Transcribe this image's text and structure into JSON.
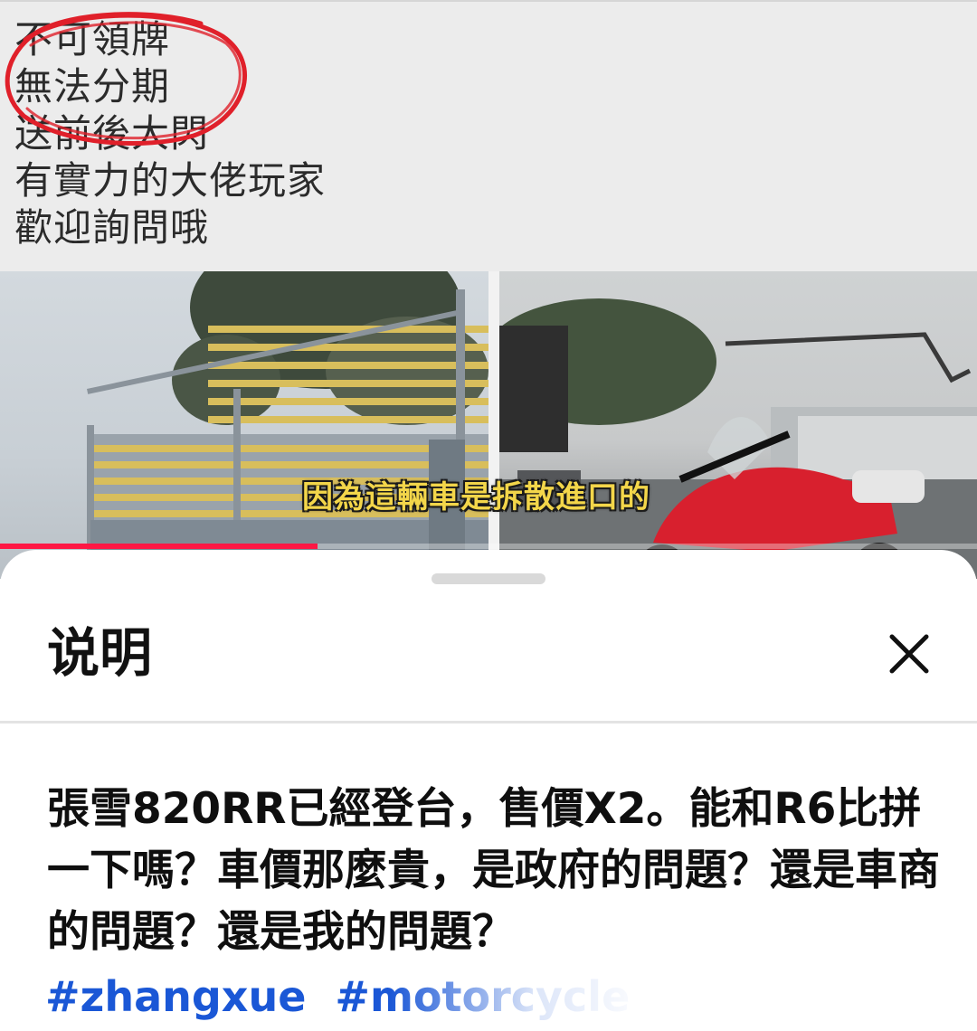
{
  "video": {
    "overlay_lines": [
      "不可領牌",
      "無法分期",
      "送前後大閃",
      "有實力的大佬玩家",
      "歡迎詢問哦"
    ],
    "subtitle": "因為這輛車是拆散進口的",
    "progress": 0.325,
    "progress_color": "#ff1744"
  },
  "sheet": {
    "title": "说明",
    "close_icon": "close-icon",
    "description": "張雪820RR已經登台，售價X2。能和R6比拼一下嗎？車價那麼貴，是政府的問題？還是車商的問題？還是我的問題？",
    "hashtags": [
      "#zhangxue",
      "#motorcycle"
    ],
    "hashtag_color": "#1a57d6"
  }
}
